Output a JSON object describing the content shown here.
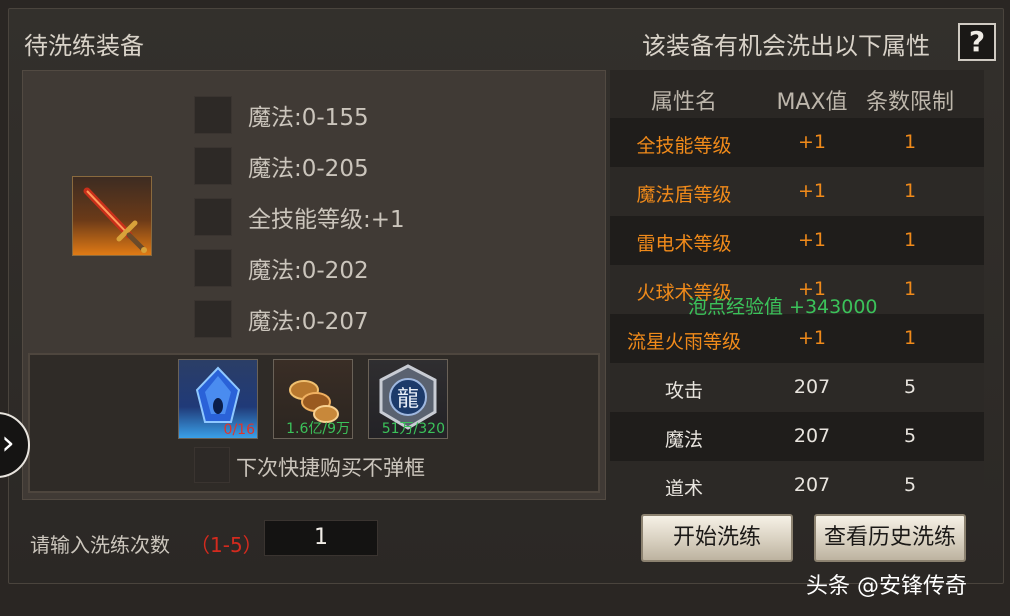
{
  "header": {
    "left_title": "待洗练装备",
    "right_title": "该装备有机会洗出以下属性",
    "help_label": "?"
  },
  "equipment": {
    "name_icon": "flame-sword-icon",
    "attributes": [
      "魔法:0-155",
      "魔法:0-205",
      "全技能等级:+1",
      "魔法:0-202",
      "魔法:0-207"
    ]
  },
  "materials": [
    {
      "icon": "blue-crystal-icon",
      "count": "0/16",
      "count_color": "#e0352b"
    },
    {
      "icon": "gold-coins-icon",
      "count": "1.6亿/9万",
      "count_color": "#3bc25a"
    },
    {
      "icon": "dragon-token-icon",
      "count": "51万/320",
      "count_color": "#3bc25a"
    }
  ],
  "quick_buy_label": "下次快捷购买不弹框",
  "table": {
    "headers": [
      "属性名",
      "MAX值",
      "条数限制"
    ],
    "rows": [
      {
        "name": "全技能等级",
        "max": "+1",
        "limit": "1",
        "highlight": true
      },
      {
        "name": "魔法盾等级",
        "max": "+1",
        "limit": "1",
        "highlight": true
      },
      {
        "name": "雷电术等级",
        "max": "+1",
        "limit": "1",
        "highlight": true
      },
      {
        "name": "火球术等级",
        "max": "+1",
        "limit": "1",
        "highlight": true
      },
      {
        "name": "流星火雨等级",
        "max": "+1",
        "limit": "1",
        "highlight": true
      },
      {
        "name": "攻击",
        "max": "207",
        "limit": "5",
        "highlight": false
      },
      {
        "name": "魔法",
        "max": "207",
        "limit": "5",
        "highlight": false
      },
      {
        "name": "道术",
        "max": "207",
        "limit": "5",
        "highlight": false
      }
    ]
  },
  "floating_text": "泡点经验值 +343000",
  "refine": {
    "count_label": "请输入洗练次数",
    "count_range": "（1-5）",
    "count_value": "1",
    "start_button": "开始洗练",
    "history_button": "查看历史洗练"
  },
  "watermark": "头条 @安锋传奇",
  "colors": {
    "highlight_orange": "#f08a1a",
    "exp_green": "#3bc25a",
    "range_red": "#d42a1e"
  }
}
